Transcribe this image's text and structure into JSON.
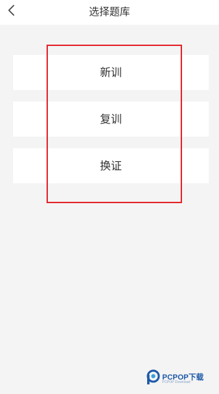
{
  "header": {
    "title": "选择题库",
    "back_icon": "chevron-left-icon"
  },
  "options": [
    {
      "label": "新训"
    },
    {
      "label": "复训"
    },
    {
      "label": "换证"
    }
  ],
  "colors": {
    "highlight": "#e4252c",
    "background": "#f4f4f4",
    "card": "#ffffff"
  },
  "watermark": {
    "text": "PCPOP下载",
    "sub": "PCPOP Download"
  }
}
